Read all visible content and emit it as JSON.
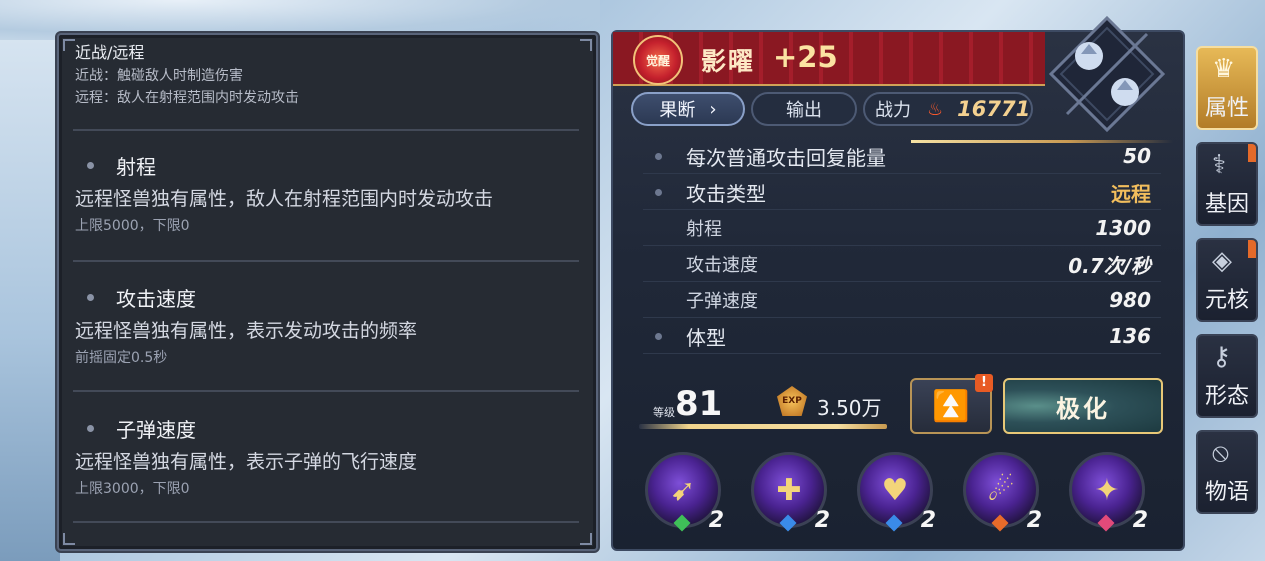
{
  "info_panel": {
    "header": {
      "title": "近战/远程",
      "lines": [
        "近战：触碰敌人时制造伤害",
        "远程：敌人在射程范围内时发动攻击"
      ]
    },
    "sections": [
      {
        "title": "射程",
        "desc": "远程怪兽独有属性，敌人在射程范围内时发动攻击",
        "sub": "上限5000，下限0"
      },
      {
        "title": "攻击速度",
        "desc": "远程怪兽独有属性，表示发动攻击的频率",
        "sub": "前摇固定0.5秒"
      },
      {
        "title": "子弹速度",
        "desc": "远程怪兽独有属性，表示子弹的飞行速度",
        "sub": "上限3000，下限0"
      }
    ]
  },
  "character": {
    "awake_label": "觉醒",
    "name": "影曜",
    "plus": "+25",
    "tabs": {
      "decisive": "果断",
      "output": "输出",
      "power_label": "战力"
    },
    "power": "16771",
    "stats": [
      {
        "label": "每次普通攻击回复能量",
        "value": "50",
        "bullet": true
      },
      {
        "label": "攻击类型",
        "value": "远程",
        "bullet": true
      },
      {
        "label": "射程",
        "value": "1300",
        "bullet": false
      },
      {
        "label": "攻击速度",
        "value": "0.7次/秒",
        "bullet": false
      },
      {
        "label": "子弹速度",
        "value": "980",
        "bullet": false
      },
      {
        "label": "体型",
        "value": "136",
        "bullet": true
      }
    ],
    "level_label": "等级",
    "level": "81",
    "exp_icon_text": "EXP",
    "exp": "3.50万",
    "upgrade_alert": "!",
    "polarize_label": "极化",
    "skills": [
      {
        "icon": "arrow-skill-icon",
        "level": "2",
        "gem": "#3fbf58"
      },
      {
        "icon": "cross-skill-icon",
        "level": "2",
        "gem": "#3a8be8"
      },
      {
        "icon": "heart-skill-icon",
        "level": "2",
        "gem": "#3a8be8"
      },
      {
        "icon": "ghost-skill-icon",
        "level": "2",
        "gem": "#e86b2a"
      },
      {
        "icon": "wolf-skill-icon",
        "level": "2",
        "gem": "#e24a7a"
      }
    ]
  },
  "side_tabs": [
    {
      "label": "属性",
      "icon": "attribute-icon",
      "active": true
    },
    {
      "label": "基因",
      "icon": "gene-icon",
      "active": false
    },
    {
      "label": "元核",
      "icon": "core-icon",
      "active": false
    },
    {
      "label": "形态",
      "icon": "form-icon",
      "active": false
    },
    {
      "label": "物语",
      "icon": "story-icon",
      "active": false
    }
  ],
  "colors": {
    "accent_gold": "#f2be5d",
    "banner_red": "#a41e2b",
    "panel_bg": "#262b33"
  }
}
